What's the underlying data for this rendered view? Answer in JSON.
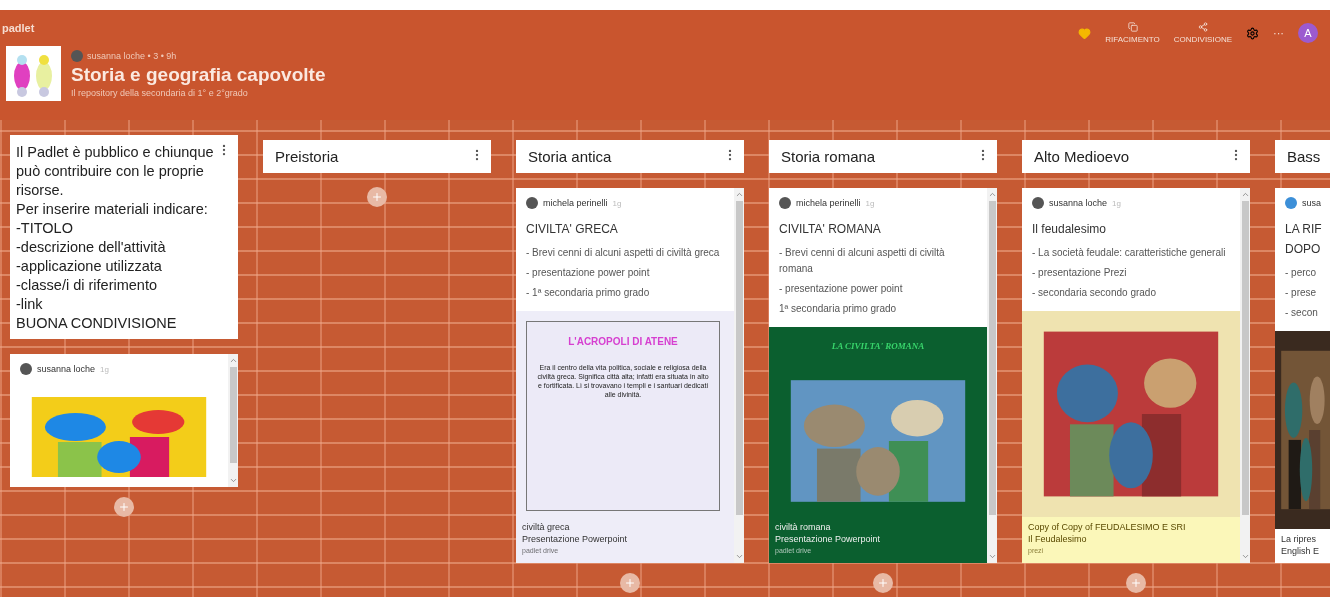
{
  "topbar": {
    "brand": "padlet"
  },
  "header": {
    "author": "susanna loche • 3 • 9h",
    "title": "Storia e geografia capovolte",
    "subtitle": "Il repository della secondaria di 1° e 2°grado",
    "actions": [
      {
        "kind": "heart"
      },
      {
        "kind": "remake",
        "label": "RIFACIMENTO"
      },
      {
        "kind": "share",
        "label": "CONDIVISIONE"
      },
      {
        "kind": "settings"
      },
      {
        "kind": "more",
        "label": "···"
      },
      {
        "kind": "avatar",
        "label": "A"
      }
    ]
  },
  "columns": [
    {
      "kind": "note",
      "lines": [
        "Il Padlet è pubblico e chiunque può contribuire con le proprie risorse.",
        "Per inserire materiali indicare:",
        "-TITOLO",
        "-descrizione dell'attività",
        "-applicazione utilizzata",
        "-classe/i di riferimento",
        "-link",
        "BUONA CONDIVISIONE"
      ],
      "posts": [
        {
          "author": "susanna loche",
          "time": "1g"
        }
      ]
    },
    {
      "kind": "section",
      "title": "Preistoria"
    },
    {
      "kind": "section",
      "title": "Storia antica",
      "posts": [
        {
          "author": "michela perinelli",
          "time": "1g",
          "title": "CIVILTA' GRECA",
          "lines": [
            "- Brevi cenni di alcuni aspetti di civiltà greca",
            "- presentazione power point",
            "- 1ª secondaria primo grado"
          ],
          "attachment": {
            "kind": "slide",
            "slide_title": "L'ACROPOLI DI ATENE",
            "slide_text": "Era il centro della vita politica, sociale e religiosa della civiltà greca. Significa città alta; infatti era situata in alto e fortificata. Lì si trovavano i templi e i santuari dedicati alle divinità.",
            "caption": [
              "civiltà greca",
              "Presentazione Powerpoint",
              "padlet drive"
            ]
          }
        }
      ]
    },
    {
      "kind": "section",
      "title": "Storia romana",
      "posts": [
        {
          "author": "michela perinelli",
          "time": "1g",
          "title": "CIVILTA' ROMANA",
          "lines": [
            "- Brevi cenni di alcuni aspetti di civiltà romana",
            "- presentazione power point",
            "1ª secondaria primo grado"
          ],
          "attachment": {
            "kind": "photo_slide",
            "slide_title": "LA CIVILTA' ROMANA",
            "caption": [
              "civiltà romana",
              "Presentazione Powerpoint",
              "padlet drive"
            ]
          }
        }
      ]
    },
    {
      "kind": "section",
      "title": "Alto Medioevo",
      "posts": [
        {
          "author": "susanna loche",
          "time": "1g",
          "title": "Il feudalesimo",
          "lines": [
            "- La società feudale: caratteristiche generali",
            "- presentazione Prezi",
            "- secondaria secondo grado"
          ],
          "attachment": {
            "kind": "illustration",
            "caption": [
              "Copy of Copy of FEUDALESIMO E SRI",
              "Il Feudalesimo",
              "prezi"
            ]
          }
        }
      ]
    },
    {
      "kind": "partial",
      "title": "Bass",
      "posts": [
        {
          "author": "susa",
          "title": "LA RIF DOPO",
          "lines": [
            "- perco",
            "- prese",
            "- secon"
          ],
          "attachment": {
            "caption": [
              "La ripres",
              "English E"
            ]
          }
        }
      ]
    }
  ]
}
